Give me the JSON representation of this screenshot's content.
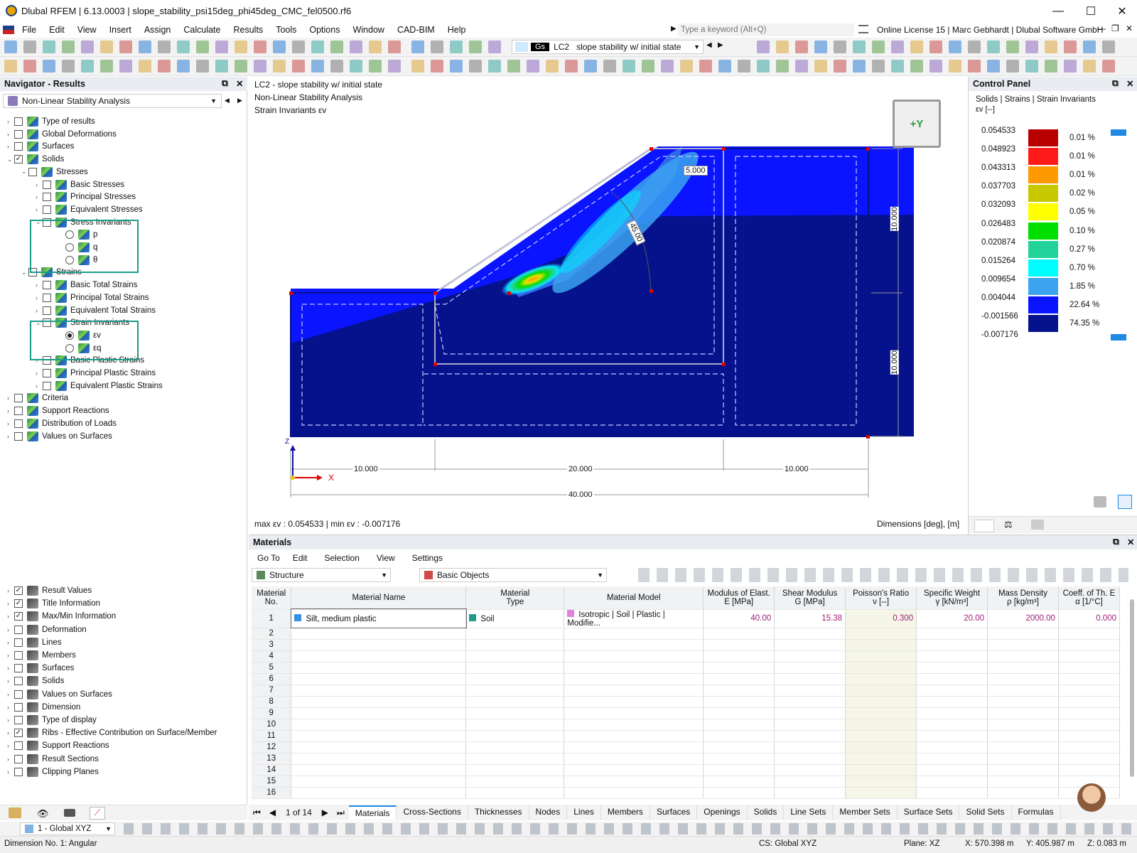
{
  "app": {
    "title": "Dlubal RFEM | 6.13.0003 | slope_stability_psi15deg_phi45deg_CMC_fel0500.rf6"
  },
  "menu": [
    "File",
    "Edit",
    "View",
    "Insert",
    "Assign",
    "Calculate",
    "Results",
    "Tools",
    "Options",
    "Window",
    "CAD-BIM",
    "Help"
  ],
  "search": {
    "placeholder": "Type a keyword (Alt+Q)"
  },
  "license": "Online License 15 | Marc Gebhardt | Dlubal Software GmbH",
  "loadcase": {
    "tag": "Gs",
    "id": "LC2",
    "name": "slope stability w/ initial state"
  },
  "navigator": {
    "title": "Navigator - Results",
    "dropdown": "Non-Linear Stability Analysis",
    "tree": [
      {
        "label": "Type of results",
        "indent": 0,
        "chev": ">",
        "check": "none"
      },
      {
        "label": "Global Deformations",
        "indent": 0,
        "chev": ">",
        "check": "none"
      },
      {
        "label": "Surfaces",
        "indent": 0,
        "chev": ">",
        "check": "none"
      },
      {
        "label": "Solids",
        "indent": 0,
        "chev": "v",
        "check": "checked"
      },
      {
        "label": "Stresses",
        "indent": 1,
        "chev": "v",
        "check": "none"
      },
      {
        "label": "Basic Stresses",
        "indent": 2,
        "chev": ">",
        "check": "none"
      },
      {
        "label": "Principal Stresses",
        "indent": 2,
        "chev": ">",
        "check": "none"
      },
      {
        "label": "Equivalent Stresses",
        "indent": 2,
        "chev": ">",
        "check": "none"
      },
      {
        "label": "Stress Invariants",
        "indent": 2,
        "chev": "v",
        "check": "none"
      },
      {
        "label": "p",
        "indent": 3,
        "radio": "off"
      },
      {
        "label": "q",
        "indent": 3,
        "radio": "off"
      },
      {
        "label": "θ",
        "indent": 3,
        "radio": "off"
      },
      {
        "label": "Strains",
        "indent": 1,
        "chev": "v",
        "check": "none"
      },
      {
        "label": "Basic Total Strains",
        "indent": 2,
        "chev": ">",
        "check": "none"
      },
      {
        "label": "Principal Total Strains",
        "indent": 2,
        "chev": ">",
        "check": "none"
      },
      {
        "label": "Equivalent Total Strains",
        "indent": 2,
        "chev": ">",
        "check": "none"
      },
      {
        "label": "Strain Invariants",
        "indent": 2,
        "chev": "v",
        "check": "none"
      },
      {
        "label": "εv",
        "indent": 3,
        "radio": "on"
      },
      {
        "label": "εq",
        "indent": 3,
        "radio": "off"
      },
      {
        "label": "Basic Plastic Strains",
        "indent": 2,
        "chev": ">",
        "check": "none"
      },
      {
        "label": "Principal Plastic Strains",
        "indent": 2,
        "chev": ">",
        "check": "none"
      },
      {
        "label": "Equivalent Plastic Strains",
        "indent": 2,
        "chev": ">",
        "check": "none"
      },
      {
        "label": "Criteria",
        "indent": 0,
        "chev": ">",
        "check": "none"
      },
      {
        "label": "Support Reactions",
        "indent": 0,
        "chev": ">",
        "check": "none"
      },
      {
        "label": "Distribution of Loads",
        "indent": 0,
        "chev": ">",
        "check": "none"
      },
      {
        "label": "Values on Surfaces",
        "indent": 0,
        "chev": ">",
        "check": "none"
      }
    ],
    "display": [
      {
        "label": "Result Values",
        "check": "checked"
      },
      {
        "label": "Title Information",
        "check": "checked"
      },
      {
        "label": "Max/Min Information",
        "check": "checked"
      },
      {
        "label": "Deformation",
        "check": "none"
      },
      {
        "label": "Lines",
        "check": "none"
      },
      {
        "label": "Members",
        "check": "none"
      },
      {
        "label": "Surfaces",
        "check": "none"
      },
      {
        "label": "Solids",
        "check": "none"
      },
      {
        "label": "Values on Surfaces",
        "check": "none"
      },
      {
        "label": "Dimension",
        "check": "none"
      },
      {
        "label": "Type of display",
        "check": "none"
      },
      {
        "label": "Ribs - Effective Contribution on Surface/Member",
        "check": "checked"
      },
      {
        "label": "Support Reactions",
        "check": "none"
      },
      {
        "label": "Result Sections",
        "check": "none"
      },
      {
        "label": "Clipping Planes",
        "check": "none"
      }
    ]
  },
  "viewport": {
    "info1": "LC2 - slope stability w/ initial state",
    "info2": "Non-Linear Stability Analysis",
    "info3": "Strain Invariants εv",
    "dims": {
      "d10a": "10.000",
      "d20": "20.000",
      "d10b": "10.000",
      "d40": "40.000",
      "v1": "10.000",
      "v2": "10.000",
      "angle": "45.00",
      "radius": "5.000"
    },
    "axis": {
      "x": "X",
      "z": "Z"
    },
    "viewcube": "+Y",
    "maxmin": "max εv : 0.054533 | min εv : -0.007176",
    "units": "Dimensions [deg], [m]"
  },
  "control_panel": {
    "title": "Control Panel",
    "subtitle": "Solids | Strains | Strain Invariants",
    "unit": "εv [--]",
    "legend": [
      {
        "value": "0.054533",
        "color": "#b80000",
        "pct": "0.01 %"
      },
      {
        "value": "0.048923",
        "color": "#ff1a1a",
        "pct": "0.01 %"
      },
      {
        "value": "0.043313",
        "color": "#ff9900",
        "pct": "0.01 %"
      },
      {
        "value": "0.037703",
        "color": "#c8c800",
        "pct": "0.02 %"
      },
      {
        "value": "0.032093",
        "color": "#ffff00",
        "pct": "0.05 %"
      },
      {
        "value": "0.026483",
        "color": "#00e000",
        "pct": "0.10 %"
      },
      {
        "value": "0.020874",
        "color": "#22d49a",
        "pct": "0.27 %"
      },
      {
        "value": "0.015264",
        "color": "#00ffff",
        "pct": "0.70 %"
      },
      {
        "value": "0.009654",
        "color": "#3ba3f0",
        "pct": "1.85 %"
      },
      {
        "value": "0.004044",
        "color": "#0a14ff",
        "pct": "22.64 %"
      },
      {
        "value": "-0.001566",
        "color": "#05128c",
        "pct": "74.35 %"
      },
      {
        "value": "-0.007176",
        "color": "",
        "pct": ""
      }
    ]
  },
  "materials": {
    "title": "Materials",
    "menu": [
      "Go To",
      "Edit",
      "Selection",
      "View",
      "Settings"
    ],
    "filter1": "Structure",
    "filter2": "Basic Objects",
    "columns": [
      {
        "l1": "Material",
        "l2": "No."
      },
      {
        "l1": "",
        "l2": "Material Name"
      },
      {
        "l1": "Material",
        "l2": "Type"
      },
      {
        "l1": "",
        "l2": "Material Model"
      },
      {
        "l1": "Modulus of Elast.",
        "l2": "E [MPa]"
      },
      {
        "l1": "Shear Modulus",
        "l2": "G [MPa]"
      },
      {
        "l1": "Poisson's Ratio",
        "l2": "ν [--]"
      },
      {
        "l1": "Specific Weight",
        "l2": "γ [kN/m³]"
      },
      {
        "l1": "Mass Density",
        "l2": "ρ [kg/m³]"
      },
      {
        "l1": "Coeff. of Th. E",
        "l2": "α [1/°C]"
      }
    ],
    "row1": {
      "no": "1",
      "name": "Silt, medium plastic",
      "type": "Soil",
      "model": "Isotropic | Soil | Plastic | Modifie...",
      "E": "40.00",
      "G": "15.38",
      "nu": "0.300",
      "gamma": "20.00",
      "rho": "2000.00",
      "alpha": "0.000"
    },
    "rownums": [
      "2",
      "3",
      "4",
      "5",
      "6",
      "7",
      "8",
      "9",
      "10",
      "11",
      "12",
      "13",
      "14",
      "15",
      "16"
    ],
    "pager": "1 of 14",
    "tabs": [
      "Materials",
      "Cross-Sections",
      "Thicknesses",
      "Nodes",
      "Lines",
      "Members",
      "Surfaces",
      "Openings",
      "Solids",
      "Line Sets",
      "Member Sets",
      "Surface Sets",
      "Solid Sets",
      "Formulas"
    ]
  },
  "bottom": {
    "cs_select": "1 - Global XYZ"
  },
  "status": {
    "left": "Dimension No. 1: Angular",
    "cs": "CS: Global XYZ",
    "plane": "Plane: XZ",
    "x": "X: 570.398 m",
    "y": "Y: 405.987 m",
    "z": "Z: 0.083 m"
  }
}
